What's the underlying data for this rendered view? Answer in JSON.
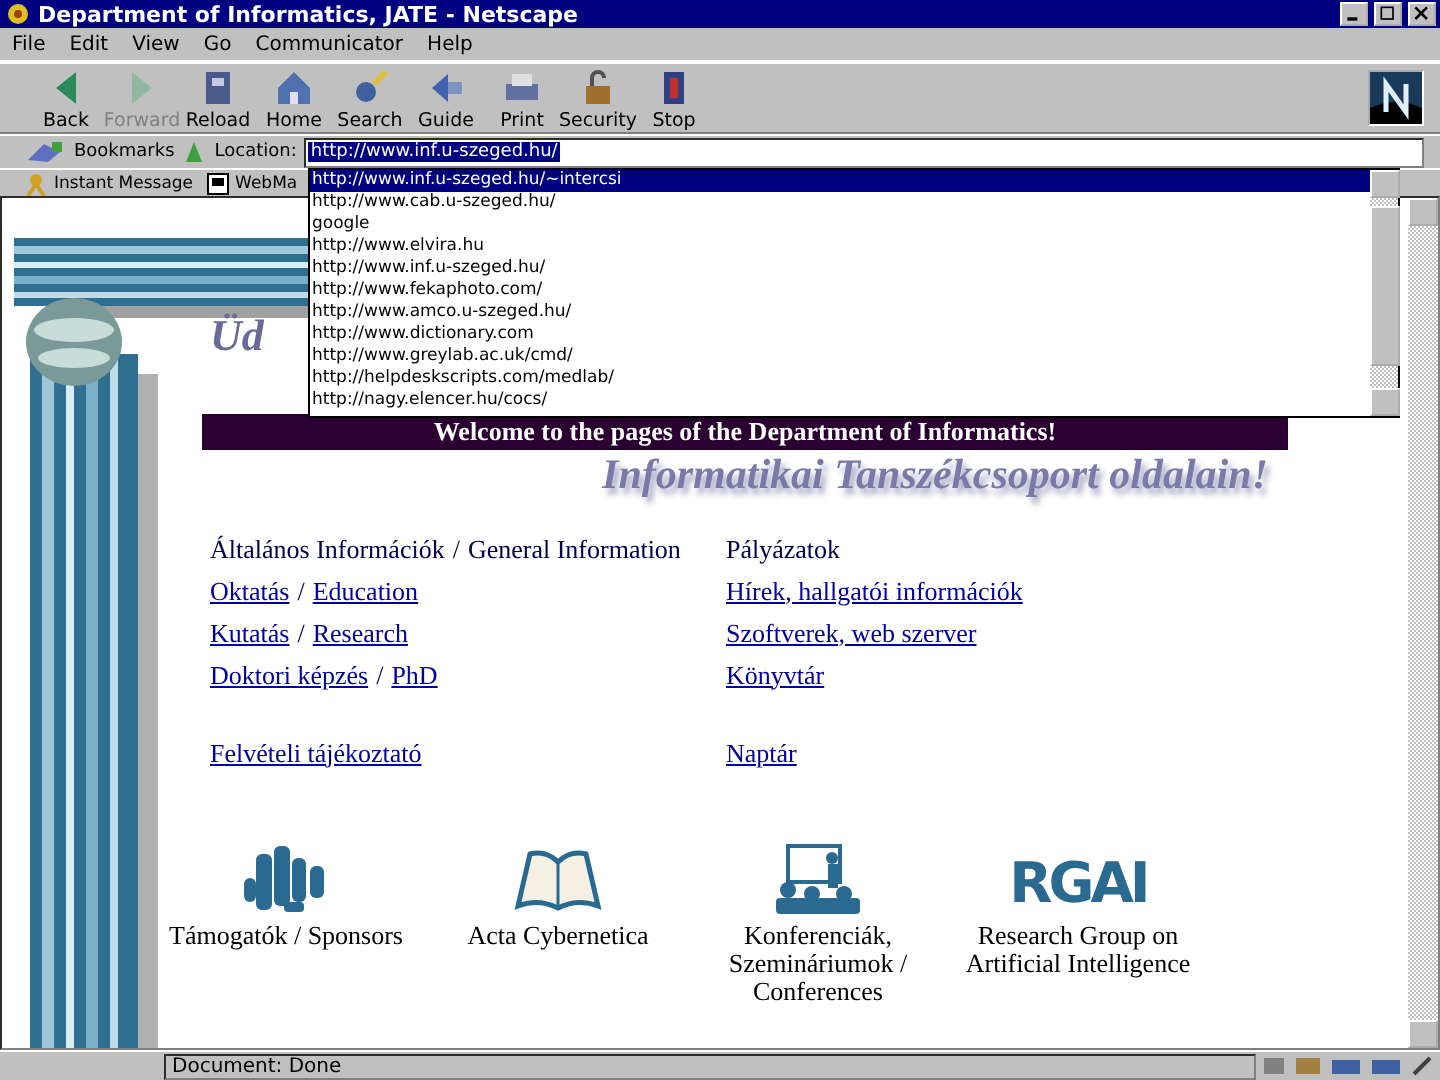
{
  "window": {
    "title": "Department of Informatics, JATE - Netscape"
  },
  "menu": [
    "File",
    "Edit",
    "View",
    "Go",
    "Communicator",
    "Help"
  ],
  "toolbar": [
    {
      "label": "Back",
      "kind": "back",
      "disabled": false
    },
    {
      "label": "Forward",
      "kind": "forward",
      "disabled": true
    },
    {
      "label": "Reload",
      "kind": "reload",
      "disabled": false
    },
    {
      "label": "Home",
      "kind": "home",
      "disabled": false
    },
    {
      "label": "Search",
      "kind": "search",
      "disabled": false
    },
    {
      "label": "Guide",
      "kind": "guide",
      "disabled": false
    },
    {
      "label": "Print",
      "kind": "print",
      "disabled": false
    },
    {
      "label": "Security",
      "kind": "security",
      "disabled": false
    },
    {
      "label": "Stop",
      "kind": "stop",
      "disabled": false
    }
  ],
  "location_bar": {
    "bookmarks": "Bookmarks",
    "label": "Location:",
    "value": "http://www.inf.u-szeged.hu/"
  },
  "personal_toolbar": [
    "Instant Message",
    "WebMa"
  ],
  "autocomplete": [
    {
      "text": "http://www.inf.u-szeged.hu/~intercsi",
      "selected": true
    },
    {
      "text": "http://www.cab.u-szeged.hu/",
      "selected": false
    },
    {
      "text": "google",
      "selected": false
    },
    {
      "text": "http://www.elvira.hu",
      "selected": false
    },
    {
      "text": "http://www.inf.u-szeged.hu/",
      "selected": false
    },
    {
      "text": "http://www.fekaphoto.com/",
      "selected": false
    },
    {
      "text": "http://www.amco.u-szeged.hu/",
      "selected": false
    },
    {
      "text": "http://www.dictionary.com",
      "selected": false
    },
    {
      "text": "http://www.greylab.ac.uk/cmd/",
      "selected": false
    },
    {
      "text": "http://helpdeskscripts.com/medlab/",
      "selected": false
    },
    {
      "text": "http://nagy.elencer.hu/cocs/",
      "selected": false
    }
  ],
  "page": {
    "heading_fragment": "Üd",
    "welcome": "Welcome to the pages of the Department of Informatics!",
    "subtitle": "Informatikai Tanszékcsoport  oldalain!",
    "link_rows": [
      {
        "left": [
          {
            "text": "Általános Információk",
            "link": false
          },
          {
            "text": "/",
            "link": false
          },
          {
            "text": "General Information",
            "link": false
          }
        ],
        "right": {
          "text": "Pályázatok",
          "link": false
        }
      },
      {
        "left": [
          {
            "text": "Oktatás",
            "link": true
          },
          {
            "text": "/",
            "link": false
          },
          {
            "text": "Education",
            "link": true
          }
        ],
        "right": {
          "text": "Hírek, hallgatói információk",
          "link": true
        }
      },
      {
        "left": [
          {
            "text": "Kutatás",
            "link": true
          },
          {
            "text": "/",
            "link": false
          },
          {
            "text": "Research",
            "link": true
          }
        ],
        "right": {
          "text": "Szoftverek, web szerver",
          "link": true
        }
      },
      {
        "left": [
          {
            "text": "Doktori képzés",
            "link": true
          },
          {
            "text": "/",
            "link": false
          },
          {
            "text": "PhD",
            "link": true
          }
        ],
        "right": {
          "text": "Könyvtár",
          "link": true
        }
      },
      {
        "left": [
          {
            "text": "Felvételi tájékoztató",
            "link": true
          }
        ],
        "right": {
          "text": "Naptár",
          "link": true
        }
      }
    ],
    "features": [
      {
        "kind": "coins",
        "caption": "Támogatók / Sponsors"
      },
      {
        "kind": "book",
        "caption": "Acta Cybernetica"
      },
      {
        "kind": "lecture",
        "caption": "Konferenciák, Szemináriumok / Conferences"
      },
      {
        "kind": "logo",
        "logo_text": "RGAI",
        "caption": "Research Group on Artificial Intelligence"
      }
    ]
  },
  "status_bar": {
    "text": "Document: Done"
  }
}
